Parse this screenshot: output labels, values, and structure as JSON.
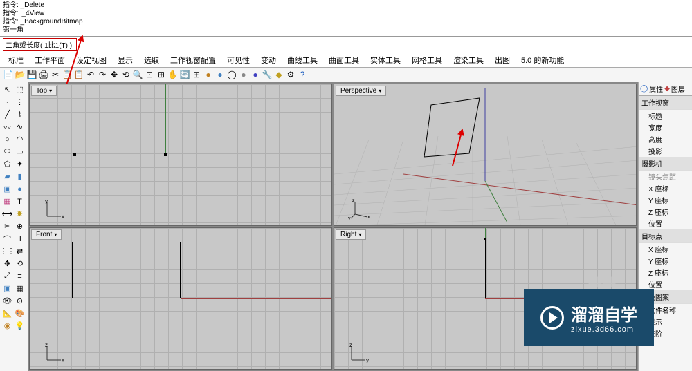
{
  "commands": {
    "line1": "指令: _Delete",
    "line2": "指令: '_4View",
    "line3": "指令: _BackgroundBitmap",
    "line4": "第一角"
  },
  "prompt": {
    "label": "二角或长度",
    "hint": "( 1比1(T) ):"
  },
  "tabs": {
    "items": [
      "标准",
      "工作平面",
      "设定视图",
      "显示",
      "选取",
      "工作视窗配置",
      "可见性",
      "变动",
      "曲线工具",
      "曲面工具",
      "实体工具",
      "网格工具",
      "渲染工具",
      "出图",
      "5.0 的新功能"
    ]
  },
  "viewports": {
    "top": "Top",
    "perspective": "Perspective",
    "front": "Front",
    "right": "Right"
  },
  "rightPanel": {
    "tabs": {
      "props": "属性",
      "layers": "图层"
    },
    "sections": [
      {
        "header": "工作视窗",
        "items": [
          "标题",
          "宽度",
          "高度",
          "投影"
        ]
      },
      {
        "header": "摄影机",
        "items": [
          "镜头焦距",
          "X 座标",
          "Y 座标",
          "Z 座标",
          "位置"
        ]
      },
      {
        "header": "目标点",
        "items": [
          "X 座标",
          "Y 座标",
          "Z 座标",
          "位置"
        ]
      },
      {
        "header": "底色图案",
        "items": [
          "文件名称",
          "显示",
          "灰阶"
        ]
      }
    ]
  },
  "watermark": {
    "text": "溜溜自学",
    "url": "zixue.3d66.com"
  },
  "axis": {
    "x": "x",
    "y": "y",
    "z": "z"
  }
}
